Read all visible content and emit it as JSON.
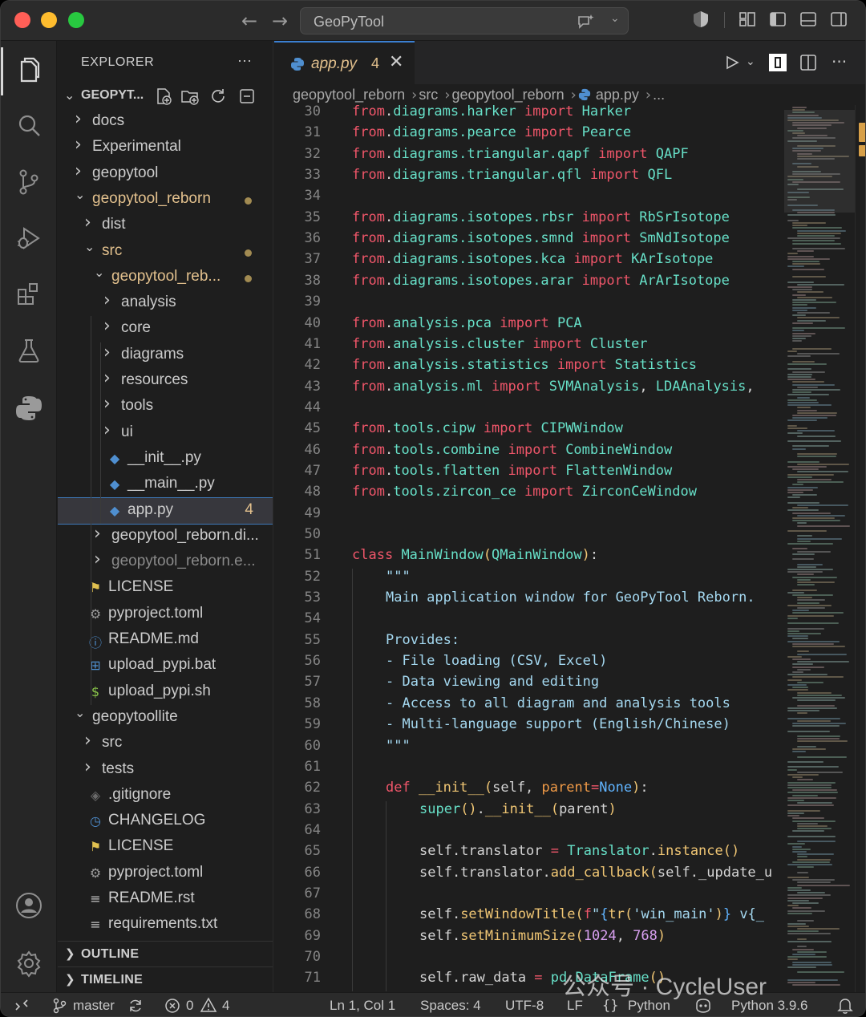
{
  "titlebar": {
    "search_text": "GeoPyTool",
    "colors": {
      "close": "#ff5f57",
      "minimize": "#febc2e",
      "zoom": "#28c840"
    }
  },
  "explorer": {
    "title": "EXPLORER",
    "more": "···",
    "root": "GEOPYT...",
    "tree": [
      {
        "label": "docs",
        "kind": "folder",
        "depth": 0,
        "open": false
      },
      {
        "label": "Experimental",
        "kind": "folder",
        "depth": 0,
        "open": false
      },
      {
        "label": "geopytool",
        "kind": "folder",
        "depth": 0,
        "open": false
      },
      {
        "label": "geopytool_reborn",
        "kind": "folder",
        "depth": 0,
        "open": true,
        "modified": true
      },
      {
        "label": "dist",
        "kind": "folder",
        "depth": 1,
        "open": false
      },
      {
        "label": "src",
        "kind": "folder",
        "depth": 1,
        "open": true,
        "modified": true
      },
      {
        "label": "geopytool_reb...",
        "kind": "folder",
        "depth": 2,
        "open": true,
        "modified": true
      },
      {
        "label": "analysis",
        "kind": "folder",
        "depth": 3,
        "open": false
      },
      {
        "label": "core",
        "kind": "folder",
        "depth": 3,
        "open": false
      },
      {
        "label": "diagrams",
        "kind": "folder",
        "depth": 3,
        "open": false
      },
      {
        "label": "resources",
        "kind": "folder",
        "depth": 3,
        "open": false
      },
      {
        "label": "tools",
        "kind": "folder",
        "depth": 3,
        "open": false
      },
      {
        "label": "ui",
        "kind": "folder",
        "depth": 3,
        "open": false
      },
      {
        "label": "__init__.py",
        "kind": "python",
        "depth": 3
      },
      {
        "label": "__main__.py",
        "kind": "python",
        "depth": 3
      },
      {
        "label": "app.py",
        "kind": "python",
        "depth": 3,
        "selected": true,
        "badge": "4"
      },
      {
        "label": "geopytool_reborn.di...",
        "kind": "folder",
        "depth": 2,
        "open": false
      },
      {
        "label": "geopytool_reborn.e...",
        "kind": "folder",
        "depth": 2,
        "open": false,
        "dim": true
      },
      {
        "label": "LICENSE",
        "kind": "license",
        "depth": 1
      },
      {
        "label": "pyproject.toml",
        "kind": "gear",
        "depth": 1
      },
      {
        "label": "README.md",
        "kind": "info",
        "depth": 1
      },
      {
        "label": "upload_pypi.bat",
        "kind": "windows",
        "depth": 1
      },
      {
        "label": "upload_pypi.sh",
        "kind": "shell",
        "depth": 1
      },
      {
        "label": "geopytoollite",
        "kind": "folder",
        "depth": 0,
        "open": true
      },
      {
        "label": "src",
        "kind": "folder",
        "depth": 1,
        "open": false
      },
      {
        "label": "tests",
        "kind": "folder",
        "depth": 1,
        "open": false
      },
      {
        "label": ".gitignore",
        "kind": "git",
        "depth": 1
      },
      {
        "label": "CHANGELOG",
        "kind": "clock",
        "depth": 1
      },
      {
        "label": "LICENSE",
        "kind": "license",
        "depth": 1
      },
      {
        "label": "pyproject.toml",
        "kind": "gear",
        "depth": 1
      },
      {
        "label": "README.rst",
        "kind": "lines",
        "depth": 1
      },
      {
        "label": "requirements.txt",
        "kind": "lines",
        "depth": 1
      }
    ],
    "outline": "OUTLINE",
    "timeline": "TIMELINE"
  },
  "tab": {
    "name": "app.py",
    "problems": "4",
    "close": "✕"
  },
  "breadcrumb": [
    "geopytool_reborn",
    "src",
    "geopytool_reborn",
    "app.py",
    "..."
  ],
  "code": [
    {
      "n": "30",
      "i": 0,
      "t": [
        [
          "kw",
          "from"
        ],
        [
          "",
          "."
        ],
        [
          "mo",
          "diagrams.harker"
        ],
        [
          "",
          " "
        ],
        [
          "kw",
          "import"
        ],
        [
          "",
          " "
        ],
        [
          "cl",
          "Harker"
        ]
      ]
    },
    {
      "n": "31",
      "i": 0,
      "t": [
        [
          "kw",
          "from"
        ],
        [
          "",
          "."
        ],
        [
          "mo",
          "diagrams.pearce"
        ],
        [
          "",
          " "
        ],
        [
          "kw",
          "import"
        ],
        [
          "",
          " "
        ],
        [
          "cl",
          "Pearce"
        ]
      ]
    },
    {
      "n": "32",
      "i": 0,
      "t": [
        [
          "kw",
          "from"
        ],
        [
          "",
          "."
        ],
        [
          "mo",
          "diagrams.triangular.qapf"
        ],
        [
          "",
          " "
        ],
        [
          "kw",
          "import"
        ],
        [
          "",
          " "
        ],
        [
          "cl",
          "QAPF"
        ]
      ]
    },
    {
      "n": "33",
      "i": 0,
      "t": [
        [
          "kw",
          "from"
        ],
        [
          "",
          "."
        ],
        [
          "mo",
          "diagrams.triangular.qfl"
        ],
        [
          "",
          " "
        ],
        [
          "kw",
          "import"
        ],
        [
          "",
          " "
        ],
        [
          "cl",
          "QFL"
        ]
      ]
    },
    {
      "n": "34",
      "i": 0,
      "t": []
    },
    {
      "n": "35",
      "i": 0,
      "t": [
        [
          "kw",
          "from"
        ],
        [
          "",
          "."
        ],
        [
          "mo",
          "diagrams.isotopes.rbsr"
        ],
        [
          "",
          " "
        ],
        [
          "kw",
          "import"
        ],
        [
          "",
          " "
        ],
        [
          "cl",
          "RbSrIsotope"
        ]
      ]
    },
    {
      "n": "36",
      "i": 0,
      "t": [
        [
          "kw",
          "from"
        ],
        [
          "",
          "."
        ],
        [
          "mo",
          "diagrams.isotopes.smnd"
        ],
        [
          "",
          " "
        ],
        [
          "kw",
          "import"
        ],
        [
          "",
          " "
        ],
        [
          "cl",
          "SmNdIsotope"
        ]
      ]
    },
    {
      "n": "37",
      "i": 0,
      "t": [
        [
          "kw",
          "from"
        ],
        [
          "",
          "."
        ],
        [
          "mo",
          "diagrams.isotopes.kca"
        ],
        [
          "",
          " "
        ],
        [
          "kw",
          "import"
        ],
        [
          "",
          " "
        ],
        [
          "cl",
          "KArIsotope"
        ]
      ]
    },
    {
      "n": "38",
      "i": 0,
      "t": [
        [
          "kw",
          "from"
        ],
        [
          "",
          "."
        ],
        [
          "mo",
          "diagrams.isotopes.arar"
        ],
        [
          "",
          " "
        ],
        [
          "kw",
          "import"
        ],
        [
          "",
          " "
        ],
        [
          "cl",
          "ArArIsotope"
        ]
      ]
    },
    {
      "n": "39",
      "i": 0,
      "t": []
    },
    {
      "n": "40",
      "i": 0,
      "t": [
        [
          "kw",
          "from"
        ],
        [
          "",
          "."
        ],
        [
          "mo",
          "analysis.pca"
        ],
        [
          "",
          " "
        ],
        [
          "kw",
          "import"
        ],
        [
          "",
          " "
        ],
        [
          "cl",
          "PCA"
        ]
      ]
    },
    {
      "n": "41",
      "i": 0,
      "t": [
        [
          "kw",
          "from"
        ],
        [
          "",
          "."
        ],
        [
          "mo",
          "analysis.cluster"
        ],
        [
          "",
          " "
        ],
        [
          "kw",
          "import"
        ],
        [
          "",
          " "
        ],
        [
          "cl",
          "Cluster"
        ]
      ]
    },
    {
      "n": "42",
      "i": 0,
      "t": [
        [
          "kw",
          "from"
        ],
        [
          "",
          "."
        ],
        [
          "mo",
          "analysis.statistics"
        ],
        [
          "",
          " "
        ],
        [
          "kw",
          "import"
        ],
        [
          "",
          " "
        ],
        [
          "cl",
          "Statistics"
        ]
      ]
    },
    {
      "n": "43",
      "i": 0,
      "t": [
        [
          "kw",
          "from"
        ],
        [
          "",
          "."
        ],
        [
          "mo",
          "analysis.ml"
        ],
        [
          "",
          " "
        ],
        [
          "kw",
          "import"
        ],
        [
          "",
          " "
        ],
        [
          "cl",
          "SVMAnalysis"
        ],
        [
          "",
          ", "
        ],
        [
          "cl",
          "LDAAnalysis"
        ],
        [
          "",
          ","
        ]
      ]
    },
    {
      "n": "44",
      "i": 0,
      "t": []
    },
    {
      "n": "45",
      "i": 0,
      "t": [
        [
          "kw",
          "from"
        ],
        [
          "",
          "."
        ],
        [
          "mo",
          "tools.cipw"
        ],
        [
          "",
          " "
        ],
        [
          "kw",
          "import"
        ],
        [
          "",
          " "
        ],
        [
          "cl",
          "CIPWWindow"
        ]
      ]
    },
    {
      "n": "46",
      "i": 0,
      "t": [
        [
          "kw",
          "from"
        ],
        [
          "",
          "."
        ],
        [
          "mo",
          "tools.combine"
        ],
        [
          "",
          " "
        ],
        [
          "kw",
          "import"
        ],
        [
          "",
          " "
        ],
        [
          "cl",
          "CombineWindow"
        ]
      ]
    },
    {
      "n": "47",
      "i": 0,
      "t": [
        [
          "kw",
          "from"
        ],
        [
          "",
          "."
        ],
        [
          "mo",
          "tools.flatten"
        ],
        [
          "",
          " "
        ],
        [
          "kw",
          "import"
        ],
        [
          "",
          " "
        ],
        [
          "cl",
          "FlattenWindow"
        ]
      ]
    },
    {
      "n": "48",
      "i": 0,
      "t": [
        [
          "kw",
          "from"
        ],
        [
          "",
          "."
        ],
        [
          "mo",
          "tools.zircon_ce"
        ],
        [
          "",
          " "
        ],
        [
          "kw",
          "import"
        ],
        [
          "",
          " "
        ],
        [
          "cl",
          "ZirconCeWindow"
        ]
      ]
    },
    {
      "n": "49",
      "i": 0,
      "t": []
    },
    {
      "n": "50",
      "i": 0,
      "t": []
    },
    {
      "n": "51",
      "i": 0,
      "t": [
        [
          "kw",
          "class"
        ],
        [
          "",
          " "
        ],
        [
          "cl",
          "MainWindow"
        ],
        [
          "fn",
          "("
        ],
        [
          "cl",
          "QMainWindow"
        ],
        [
          "fn",
          ")"
        ],
        [
          "",
          ":"
        ]
      ]
    },
    {
      "n": "52",
      "i": 1,
      "t": [
        [
          "ds",
          "\"\"\""
        ]
      ]
    },
    {
      "n": "53",
      "i": 1,
      "t": [
        [
          "ds",
          "Main application window for GeoPyTool Reborn."
        ]
      ]
    },
    {
      "n": "54",
      "i": 0,
      "t": []
    },
    {
      "n": "55",
      "i": 1,
      "t": [
        [
          "ds",
          "Provides:"
        ]
      ]
    },
    {
      "n": "56",
      "i": 1,
      "t": [
        [
          "ds",
          "- File loading (CSV, Excel)"
        ]
      ]
    },
    {
      "n": "57",
      "i": 1,
      "t": [
        [
          "ds",
          "- Data viewing and editing"
        ]
      ]
    },
    {
      "n": "58",
      "i": 1,
      "t": [
        [
          "ds",
          "- Access to all diagram and analysis tools"
        ]
      ]
    },
    {
      "n": "59",
      "i": 1,
      "t": [
        [
          "ds",
          "- Multi-language support (English/Chinese)"
        ]
      ]
    },
    {
      "n": "60",
      "i": 1,
      "t": [
        [
          "ds",
          "\"\"\""
        ]
      ]
    },
    {
      "n": "61",
      "i": 0,
      "t": []
    },
    {
      "n": "62",
      "i": 1,
      "t": [
        [
          "kw",
          "def"
        ],
        [
          "",
          " "
        ],
        [
          "fn",
          "__init__"
        ],
        [
          "fn",
          "("
        ],
        [
          "",
          "self, "
        ],
        [
          "bi",
          "parent"
        ],
        [
          "kw",
          "="
        ],
        [
          "bl",
          "None"
        ],
        [
          "fn",
          ")"
        ],
        [
          "",
          ":"
        ]
      ]
    },
    {
      "n": "63",
      "i": 2,
      "t": [
        [
          "cl",
          "super"
        ],
        [
          "fn",
          "()"
        ],
        [
          "",
          "."
        ],
        [
          "fn",
          "__init__"
        ],
        [
          "fn",
          "("
        ],
        [
          "",
          "parent"
        ],
        [
          "fn",
          ")"
        ]
      ]
    },
    {
      "n": "64",
      "i": 0,
      "t": []
    },
    {
      "n": "65",
      "i": 2,
      "t": [
        [
          "",
          "self.translator "
        ],
        [
          "kw",
          "="
        ],
        [
          "",
          " "
        ],
        [
          "cl",
          "Translator"
        ],
        [
          "",
          "."
        ],
        [
          "fn",
          "instance"
        ],
        [
          "fn",
          "()"
        ]
      ]
    },
    {
      "n": "66",
      "i": 2,
      "t": [
        [
          "",
          "self.translator."
        ],
        [
          "fn",
          "add_callback"
        ],
        [
          "fn",
          "("
        ],
        [
          "",
          "self._update_u"
        ]
      ]
    },
    {
      "n": "67",
      "i": 0,
      "t": []
    },
    {
      "n": "68",
      "i": 2,
      "t": [
        [
          "",
          "self."
        ],
        [
          "fn",
          "setWindowTitle"
        ],
        [
          "fn",
          "("
        ],
        [
          "kw",
          "f"
        ],
        [
          "st",
          "\""
        ],
        [
          "bl",
          "{"
        ],
        [
          "fn",
          "tr"
        ],
        [
          "fn",
          "("
        ],
        [
          "st",
          "'win_main'"
        ],
        [
          "fn",
          ")"
        ],
        [
          "bl",
          "}"
        ],
        [
          "st",
          " v{_"
        ]
      ]
    },
    {
      "n": "69",
      "i": 2,
      "t": [
        [
          "",
          "self."
        ],
        [
          "fn",
          "setMinimumSize"
        ],
        [
          "fn",
          "("
        ],
        [
          "nm",
          "1024"
        ],
        [
          "",
          ", "
        ],
        [
          "nm",
          "768"
        ],
        [
          "fn",
          ")"
        ]
      ]
    },
    {
      "n": "70",
      "i": 0,
      "t": []
    },
    {
      "n": "71",
      "i": 2,
      "t": [
        [
          "",
          "self.raw_data "
        ],
        [
          "kw",
          "="
        ],
        [
          "",
          " "
        ],
        [
          "cl",
          "pd"
        ],
        [
          "",
          "."
        ],
        [
          "cl",
          "DataFrame"
        ],
        [
          "fn",
          "()"
        ]
      ]
    }
  ],
  "statusbar": {
    "branch": "master",
    "errors": "0",
    "warnings": "4",
    "position": "Ln 1, Col 1",
    "spaces": "Spaces: 4",
    "encoding": "UTF-8",
    "eol": "LF",
    "language": "Python",
    "interpreter": "Python 3.9.6"
  },
  "watermark": "公众号 · CycleUser"
}
